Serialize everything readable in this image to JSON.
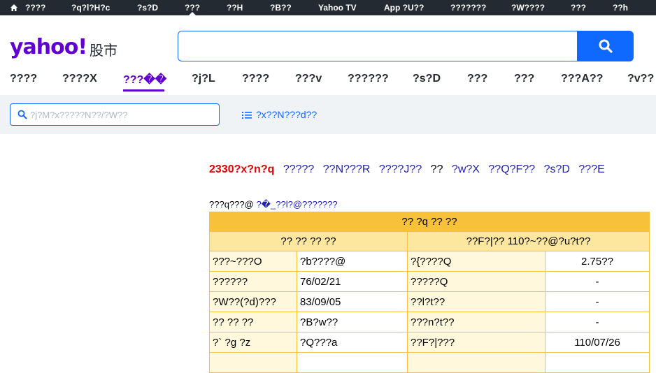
{
  "topbar": {
    "items": [
      "????",
      "?q?l?H?c",
      "?s?D",
      "???",
      "??H",
      "?B??",
      "Yahoo TV",
      "App ?U??",
      "???????",
      "?W????",
      "???",
      "??h"
    ]
  },
  "header": {
    "logo": "yahoo!",
    "logo_sub": "股市",
    "search_placeholder": ""
  },
  "nav": {
    "tabs": [
      "????",
      "????X",
      "???��",
      "?j?L",
      "????",
      "???v",
      "??????",
      "?s?D",
      "???",
      "???",
      "???A??",
      "?v??"
    ]
  },
  "subbar": {
    "search_placeholder": "?j?M?x?????N??/?W??",
    "list_link": "?x??N???d??"
  },
  "stock": {
    "code": "2330?x?n?q",
    "links": [
      "?????",
      "??N???R",
      "????J??",
      "??",
      "?w?X",
      "??Q?F??",
      "?s?D",
      "???E"
    ],
    "source_label": "???q???@",
    "source_link": "?�_??l?@???????"
  },
  "table": {
    "title": "?? ?q ?? ??",
    "header_left": "?? ?? ?? ??",
    "header_right": "??F?|?? 110?~??@?u?t??",
    "rows": [
      [
        "???~???O",
        "?b????@",
        "?{????Q",
        "2.75??"
      ],
      [
        "??????",
        "76/02/21",
        "?????Q",
        "-"
      ],
      [
        "?W??(?d)???",
        "83/09/05",
        "??l?t??",
        "-"
      ],
      [
        "?? ?? ??",
        "?B?w??",
        "???n?t??",
        "-"
      ],
      [
        "?` ?g ?z",
        "?Q???a",
        "??F?|???",
        "110/07/26"
      ]
    ]
  },
  "colors": {
    "topbar_bg": "#232a31",
    "brand": "#6001d2",
    "accent_blue": "#0f69ff",
    "code_red": "#e60000",
    "table_title_bg": "#f8c13a",
    "table_header_bg": "#fde79e"
  }
}
